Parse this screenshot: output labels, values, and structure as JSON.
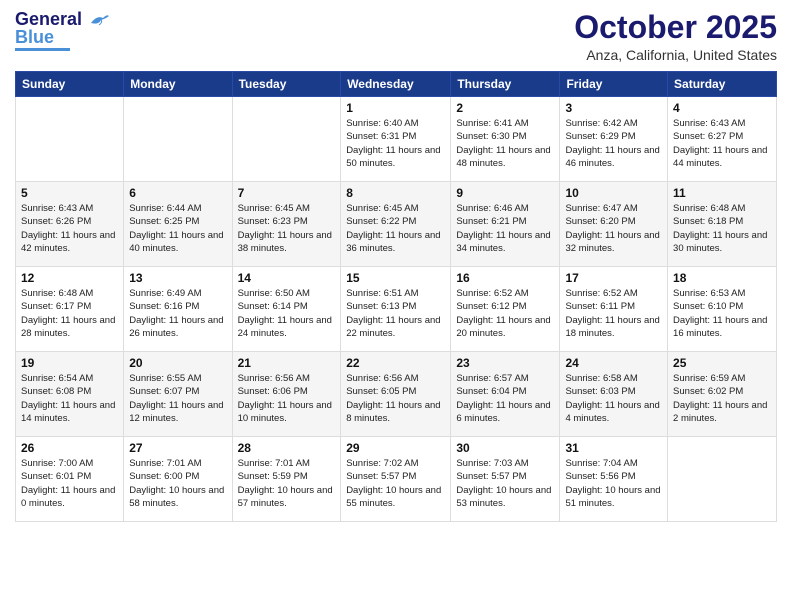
{
  "logo": {
    "text_general": "General",
    "text_blue": "Blue"
  },
  "header": {
    "month": "October 2025",
    "location": "Anza, California, United States"
  },
  "weekdays": [
    "Sunday",
    "Monday",
    "Tuesday",
    "Wednesday",
    "Thursday",
    "Friday",
    "Saturday"
  ],
  "weeks": [
    [
      {
        "day": "",
        "sunrise": "",
        "sunset": "",
        "daylight": ""
      },
      {
        "day": "",
        "sunrise": "",
        "sunset": "",
        "daylight": ""
      },
      {
        "day": "",
        "sunrise": "",
        "sunset": "",
        "daylight": ""
      },
      {
        "day": "1",
        "sunrise": "Sunrise: 6:40 AM",
        "sunset": "Sunset: 6:31 PM",
        "daylight": "Daylight: 11 hours and 50 minutes."
      },
      {
        "day": "2",
        "sunrise": "Sunrise: 6:41 AM",
        "sunset": "Sunset: 6:30 PM",
        "daylight": "Daylight: 11 hours and 48 minutes."
      },
      {
        "day": "3",
        "sunrise": "Sunrise: 6:42 AM",
        "sunset": "Sunset: 6:29 PM",
        "daylight": "Daylight: 11 hours and 46 minutes."
      },
      {
        "day": "4",
        "sunrise": "Sunrise: 6:43 AM",
        "sunset": "Sunset: 6:27 PM",
        "daylight": "Daylight: 11 hours and 44 minutes."
      }
    ],
    [
      {
        "day": "5",
        "sunrise": "Sunrise: 6:43 AM",
        "sunset": "Sunset: 6:26 PM",
        "daylight": "Daylight: 11 hours and 42 minutes."
      },
      {
        "day": "6",
        "sunrise": "Sunrise: 6:44 AM",
        "sunset": "Sunset: 6:25 PM",
        "daylight": "Daylight: 11 hours and 40 minutes."
      },
      {
        "day": "7",
        "sunrise": "Sunrise: 6:45 AM",
        "sunset": "Sunset: 6:23 PM",
        "daylight": "Daylight: 11 hours and 38 minutes."
      },
      {
        "day": "8",
        "sunrise": "Sunrise: 6:45 AM",
        "sunset": "Sunset: 6:22 PM",
        "daylight": "Daylight: 11 hours and 36 minutes."
      },
      {
        "day": "9",
        "sunrise": "Sunrise: 6:46 AM",
        "sunset": "Sunset: 6:21 PM",
        "daylight": "Daylight: 11 hours and 34 minutes."
      },
      {
        "day": "10",
        "sunrise": "Sunrise: 6:47 AM",
        "sunset": "Sunset: 6:20 PM",
        "daylight": "Daylight: 11 hours and 32 minutes."
      },
      {
        "day": "11",
        "sunrise": "Sunrise: 6:48 AM",
        "sunset": "Sunset: 6:18 PM",
        "daylight": "Daylight: 11 hours and 30 minutes."
      }
    ],
    [
      {
        "day": "12",
        "sunrise": "Sunrise: 6:48 AM",
        "sunset": "Sunset: 6:17 PM",
        "daylight": "Daylight: 11 hours and 28 minutes."
      },
      {
        "day": "13",
        "sunrise": "Sunrise: 6:49 AM",
        "sunset": "Sunset: 6:16 PM",
        "daylight": "Daylight: 11 hours and 26 minutes."
      },
      {
        "day": "14",
        "sunrise": "Sunrise: 6:50 AM",
        "sunset": "Sunset: 6:14 PM",
        "daylight": "Daylight: 11 hours and 24 minutes."
      },
      {
        "day": "15",
        "sunrise": "Sunrise: 6:51 AM",
        "sunset": "Sunset: 6:13 PM",
        "daylight": "Daylight: 11 hours and 22 minutes."
      },
      {
        "day": "16",
        "sunrise": "Sunrise: 6:52 AM",
        "sunset": "Sunset: 6:12 PM",
        "daylight": "Daylight: 11 hours and 20 minutes."
      },
      {
        "day": "17",
        "sunrise": "Sunrise: 6:52 AM",
        "sunset": "Sunset: 6:11 PM",
        "daylight": "Daylight: 11 hours and 18 minutes."
      },
      {
        "day": "18",
        "sunrise": "Sunrise: 6:53 AM",
        "sunset": "Sunset: 6:10 PM",
        "daylight": "Daylight: 11 hours and 16 minutes."
      }
    ],
    [
      {
        "day": "19",
        "sunrise": "Sunrise: 6:54 AM",
        "sunset": "Sunset: 6:08 PM",
        "daylight": "Daylight: 11 hours and 14 minutes."
      },
      {
        "day": "20",
        "sunrise": "Sunrise: 6:55 AM",
        "sunset": "Sunset: 6:07 PM",
        "daylight": "Daylight: 11 hours and 12 minutes."
      },
      {
        "day": "21",
        "sunrise": "Sunrise: 6:56 AM",
        "sunset": "Sunset: 6:06 PM",
        "daylight": "Daylight: 11 hours and 10 minutes."
      },
      {
        "day": "22",
        "sunrise": "Sunrise: 6:56 AM",
        "sunset": "Sunset: 6:05 PM",
        "daylight": "Daylight: 11 hours and 8 minutes."
      },
      {
        "day": "23",
        "sunrise": "Sunrise: 6:57 AM",
        "sunset": "Sunset: 6:04 PM",
        "daylight": "Daylight: 11 hours and 6 minutes."
      },
      {
        "day": "24",
        "sunrise": "Sunrise: 6:58 AM",
        "sunset": "Sunset: 6:03 PM",
        "daylight": "Daylight: 11 hours and 4 minutes."
      },
      {
        "day": "25",
        "sunrise": "Sunrise: 6:59 AM",
        "sunset": "Sunset: 6:02 PM",
        "daylight": "Daylight: 11 hours and 2 minutes."
      }
    ],
    [
      {
        "day": "26",
        "sunrise": "Sunrise: 7:00 AM",
        "sunset": "Sunset: 6:01 PM",
        "daylight": "Daylight: 11 hours and 0 minutes."
      },
      {
        "day": "27",
        "sunrise": "Sunrise: 7:01 AM",
        "sunset": "Sunset: 6:00 PM",
        "daylight": "Daylight: 10 hours and 58 minutes."
      },
      {
        "day": "28",
        "sunrise": "Sunrise: 7:01 AM",
        "sunset": "Sunset: 5:59 PM",
        "daylight": "Daylight: 10 hours and 57 minutes."
      },
      {
        "day": "29",
        "sunrise": "Sunrise: 7:02 AM",
        "sunset": "Sunset: 5:57 PM",
        "daylight": "Daylight: 10 hours and 55 minutes."
      },
      {
        "day": "30",
        "sunrise": "Sunrise: 7:03 AM",
        "sunset": "Sunset: 5:57 PM",
        "daylight": "Daylight: 10 hours and 53 minutes."
      },
      {
        "day": "31",
        "sunrise": "Sunrise: 7:04 AM",
        "sunset": "Sunset: 5:56 PM",
        "daylight": "Daylight: 10 hours and 51 minutes."
      },
      {
        "day": "",
        "sunrise": "",
        "sunset": "",
        "daylight": ""
      }
    ]
  ]
}
